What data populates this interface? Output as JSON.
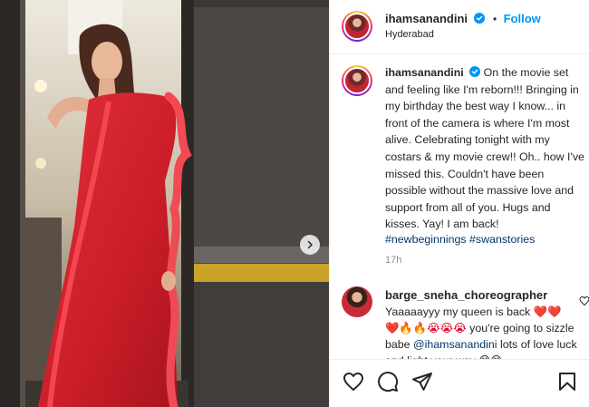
{
  "post": {
    "username": "ihamsanandini",
    "follow_label": "Follow",
    "separator": "•",
    "location": "Hyderabad",
    "caption": "On the movie set and feeling like I'm reborn!!! Bringing in my birthday the best way I know... in front of the camera is where I'm most alive. Celebrating tonight with my costars & my movie crew!! Oh.. how I've missed this. Couldn't have been possible without the massive love and support from all of you. Hugs and kisses. Yay! I am back!",
    "hashtags": [
      "#newbeginnings",
      "#swanstories"
    ],
    "time": "17h"
  },
  "comment": {
    "username": "barge_sneha_choreographer",
    "text_1": "Yaaaaayyy my queen is back",
    "emoji_1": "❤️❤️",
    "emoji_2": "❤️🔥🔥😭😭😭",
    "text_2": "you're going to sizzle babe",
    "mention": "@ihamsanandini",
    "text_3": "lots of love luck and light your way",
    "emoji_3": "😊😊"
  },
  "icons": {
    "like": "heart-icon",
    "comment": "comment-icon",
    "share": "share-icon",
    "save": "bookmark-icon",
    "next": "chevron-right-icon",
    "verified": "verified-badge-icon"
  },
  "colors": {
    "accent": "#0095f6",
    "saree": "#d8232e",
    "hashtag": "#00376b"
  }
}
